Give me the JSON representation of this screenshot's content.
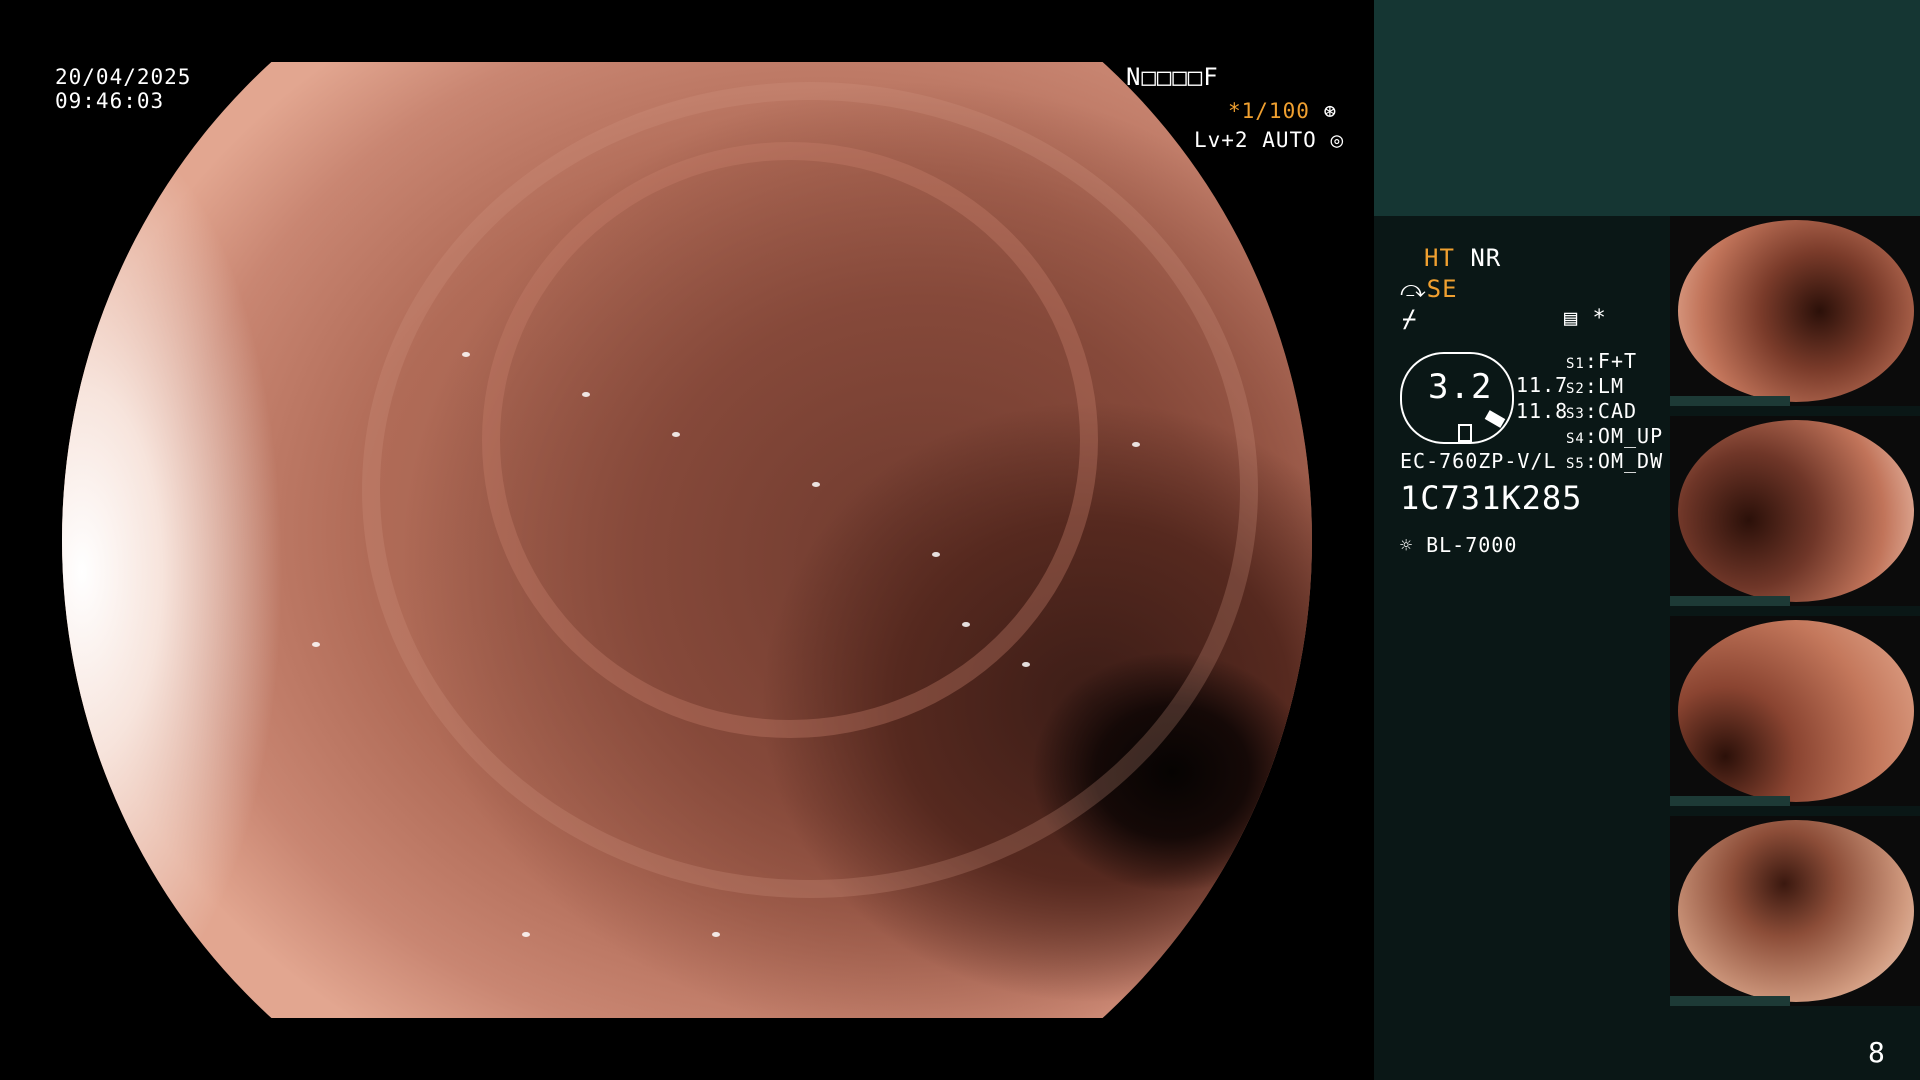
{
  "overlay": {
    "date": "20/04/2025",
    "time": "09:46:03",
    "name_field": "N□□□□F",
    "shutter": "*1/100",
    "level": "Lv+2 AUTO"
  },
  "settings": {
    "ht": "HT",
    "nr": "NR",
    "se": "SE",
    "star": "*"
  },
  "meter": {
    "value": "3.2",
    "values": [
      "11.7",
      "11.8"
    ]
  },
  "scope_info": {
    "model": "EC-760ZP-V/L",
    "serial": "1C731K285",
    "light_source": "BL-7000"
  },
  "modes": [
    {
      "key": "S1",
      "value": "F+T"
    },
    {
      "key": "S2",
      "value": "LM"
    },
    {
      "key": "S3",
      "value": "CAD"
    },
    {
      "key": "S4",
      "value": "OM_UP"
    },
    {
      "key": "S5",
      "value": "OM_DW"
    }
  ],
  "thumbnails": {
    "count": 4,
    "serial_label": "1C731K285"
  },
  "page_number": "8",
  "colors": {
    "accent": "#f0a030",
    "panel_top": "#153633",
    "panel_bottom": "#0a1716"
  },
  "icons": [
    "shutter-icon",
    "auto-icon",
    "scope-icon",
    "freeze-icon",
    "settings-icon",
    "light-icon"
  ]
}
